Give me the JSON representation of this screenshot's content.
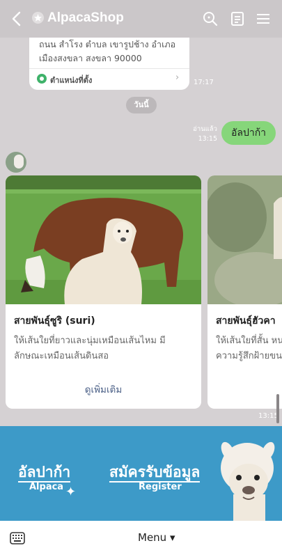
{
  "header": {
    "title": "AlpacaShop",
    "icons": [
      "back-icon",
      "star-icon",
      "search-icon",
      "notes-icon",
      "hamburger-menu-icon"
    ]
  },
  "chat": {
    "location": {
      "address": "ถนน สำโรง ตำบล เขารูปช้าง อำเภอเมืองสงขลา สงขลา 90000",
      "link_label": "ตำแหน่งที่ตั้ง",
      "time": "17:17"
    },
    "date_label": "วันนี้",
    "my_message": {
      "read_label": "อ่านแล้ว",
      "time": "13:15",
      "text": "อัลปาก้า"
    },
    "cards": [
      {
        "title": "สายพันธุ์ซูริ (suri)",
        "description": "ให้เส้นใยที่ยาวและนุ่มเหมือนเส้นไหม มีลักษณะเหมือนเส้นดินสอ",
        "link": "ดูเพิ่มเติม"
      },
      {
        "title": "สายพันธุ์ฮัวคา",
        "description": "ให้เส้นใยที่สั้น หน ความรู้สึกฝ้ายขน"
      }
    ],
    "cards_time": "13:15"
  },
  "banner": {
    "left_th": "อัลปาก้า",
    "left_en": "Alpaca",
    "right_th": "สมัครรับข้อมูล",
    "right_en": "Register",
    "color": "#3d9ac8"
  },
  "bottom": {
    "menu_label": "Menu ▾"
  },
  "colors": {
    "my_bubble": "#86d67a",
    "chat_bg": "#d5d1d3",
    "link": "#4a5f86"
  }
}
